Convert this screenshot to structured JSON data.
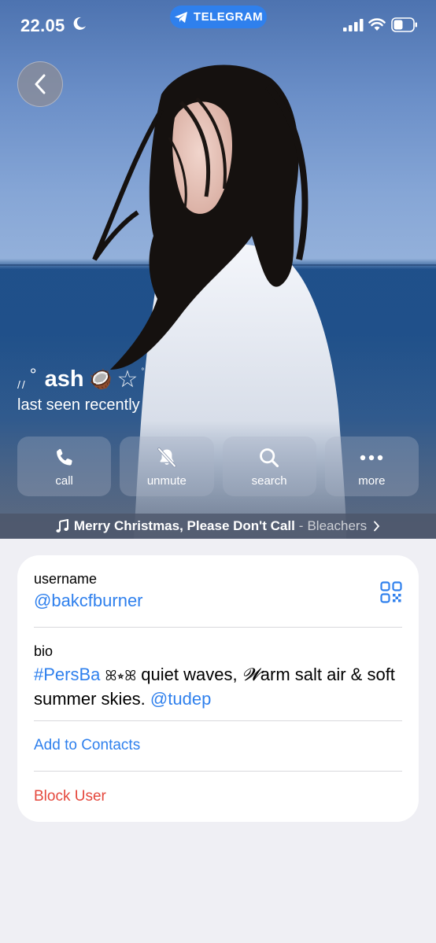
{
  "status": {
    "time": "22.05",
    "pill_label": "TELEGRAM"
  },
  "profile": {
    "deco_left": "//",
    "deco_degree": "°",
    "name": "ash",
    "name_emoji": "🥥",
    "deco_star": "☆",
    "deco_right": "°",
    "status": "last seen recently"
  },
  "actions": [
    {
      "label": "call",
      "icon": "phone-icon"
    },
    {
      "label": "unmute",
      "icon": "bell-slash-icon"
    },
    {
      "label": "search",
      "icon": "search-icon"
    },
    {
      "label": "more",
      "icon": "ellipsis-icon"
    }
  ],
  "music": {
    "song": "Merry Christmas, Please Don't Call",
    "separator": "-",
    "artist": "Bleachers"
  },
  "info": {
    "username_label": "username",
    "username": "@bakcfburner",
    "bio_label": "bio",
    "bio_tag": "#PersBa",
    "bio_deco": "ꕤ⭒ꕤ",
    "bio_text1": " quiet waves, ",
    "bio_w": "𝓦",
    "bio_text2": "arm salt air & soft summer skies. ",
    "bio_mention": "@tudep",
    "add_contacts": "Add to Contacts",
    "block_user": "Block User"
  },
  "colors": {
    "accent": "#2f80ed",
    "danger": "#e5483d",
    "background": "#efeff4"
  }
}
